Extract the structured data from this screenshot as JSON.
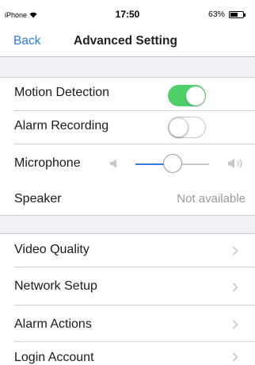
{
  "status_bar": {
    "carrier": "iPhone",
    "wifi_icon": "wifi-icon",
    "time": "17:50",
    "battery_percent": "63%",
    "battery_level": 0.63
  },
  "nav": {
    "back_label": "Back",
    "title": "Advanced Setting"
  },
  "settings_group_1": {
    "motion_detection": {
      "label": "Motion Detection",
      "enabled": true
    },
    "alarm_recording": {
      "label": "Alarm Recording",
      "enabled": false
    },
    "microphone": {
      "label": "Microphone",
      "volume_level": 0.5,
      "low_icon": "speaker-low-icon",
      "high_icon": "speaker-high-icon"
    },
    "speaker": {
      "label": "Speaker",
      "value": "Not available"
    }
  },
  "settings_group_2": {
    "items": [
      {
        "label": "Video Quality"
      },
      {
        "label": "Network Setup"
      },
      {
        "label": "Alarm Actions"
      },
      {
        "label": "Login Account"
      }
    ]
  },
  "colors": {
    "accent": "#2f7ce8",
    "toggle_on": "#4fcf68",
    "group_background": "#efeff4"
  }
}
